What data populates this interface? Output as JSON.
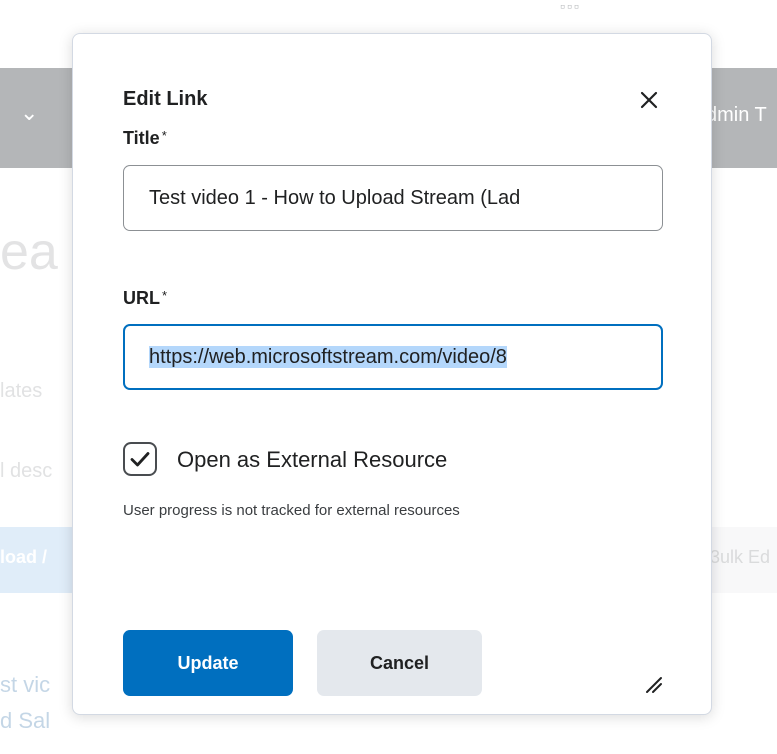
{
  "background": {
    "navbar_user": "dmin T",
    "heading_fragment": "ea",
    "text_line_1": "lates",
    "text_line_2": "l desc",
    "upload_button": "load /",
    "bulk_edit": "3ulk Ed",
    "link_line_1": "st vic",
    "link_line_2": "d Sal"
  },
  "dialog": {
    "title": "Edit Link",
    "close_icon": "close-icon",
    "fields": {
      "title": {
        "label": "Title",
        "required_mark": "*",
        "value": "Test video 1 - How to Upload Stream (Lad"
      },
      "url": {
        "label": "URL",
        "required_mark": "*",
        "value": "https://web.microsoftstream.com/video/8"
      }
    },
    "external": {
      "checked": true,
      "label": "Open as External Resource",
      "help": "User progress is not tracked for external resources"
    },
    "buttons": {
      "update": "Update",
      "cancel": "Cancel"
    }
  },
  "colors": {
    "primary": "#006fbf",
    "secondary": "#e4e8ed",
    "navbar": "#6f7478"
  }
}
